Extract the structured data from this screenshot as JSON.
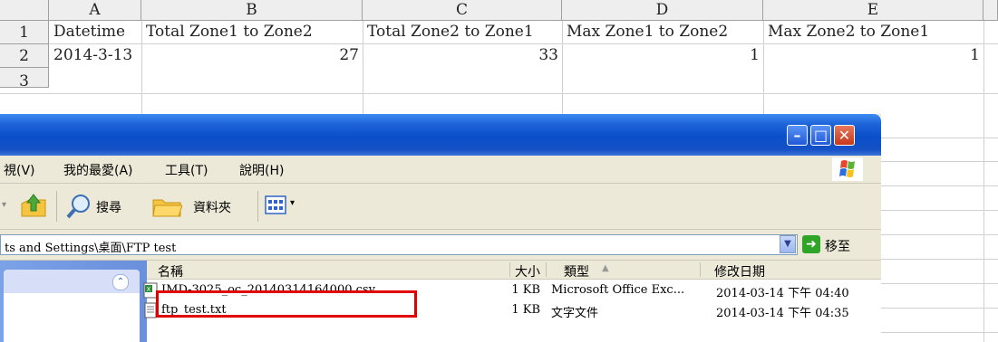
{
  "spreadsheet": {
    "columns": [
      "A",
      "B",
      "C",
      "D",
      "E"
    ],
    "rows": [
      "1",
      "2",
      "3"
    ],
    "row1": [
      "Datetime",
      "Total Zone1 to Zone2",
      "Total Zone2 to Zone1",
      "Max Zone1 to Zone2",
      "Max Zone2 to Zone1"
    ],
    "row2": [
      "2014-3-13",
      "27",
      "33",
      "1",
      "1"
    ]
  },
  "explorer": {
    "menu": [
      "視(V)",
      "我的最愛(A)",
      "工具(T)",
      "說明(H)"
    ],
    "toolbar": {
      "search": "搜尋",
      "folders": "資料夾"
    },
    "address": "ts and Settings\\桌面\\FTP test",
    "go_label": "移至",
    "columns": {
      "name": "名稱",
      "size": "大小",
      "type": "類型",
      "modified": "修改日期"
    },
    "files": [
      {
        "name": "IMD-3025_oc_20140314164000.csv",
        "size": "1 KB",
        "type": "Microsoft Office Exc...",
        "modified": "2014-03-14 下午 04:40"
      },
      {
        "name": "ftp_test.txt",
        "size": "1 KB",
        "type": "文字文件",
        "modified": "2014-03-14 下午 04:35"
      }
    ]
  },
  "colors": {
    "titlebar": "#0a4fc9",
    "highlight": "#e00000",
    "go": "#2fa528"
  }
}
